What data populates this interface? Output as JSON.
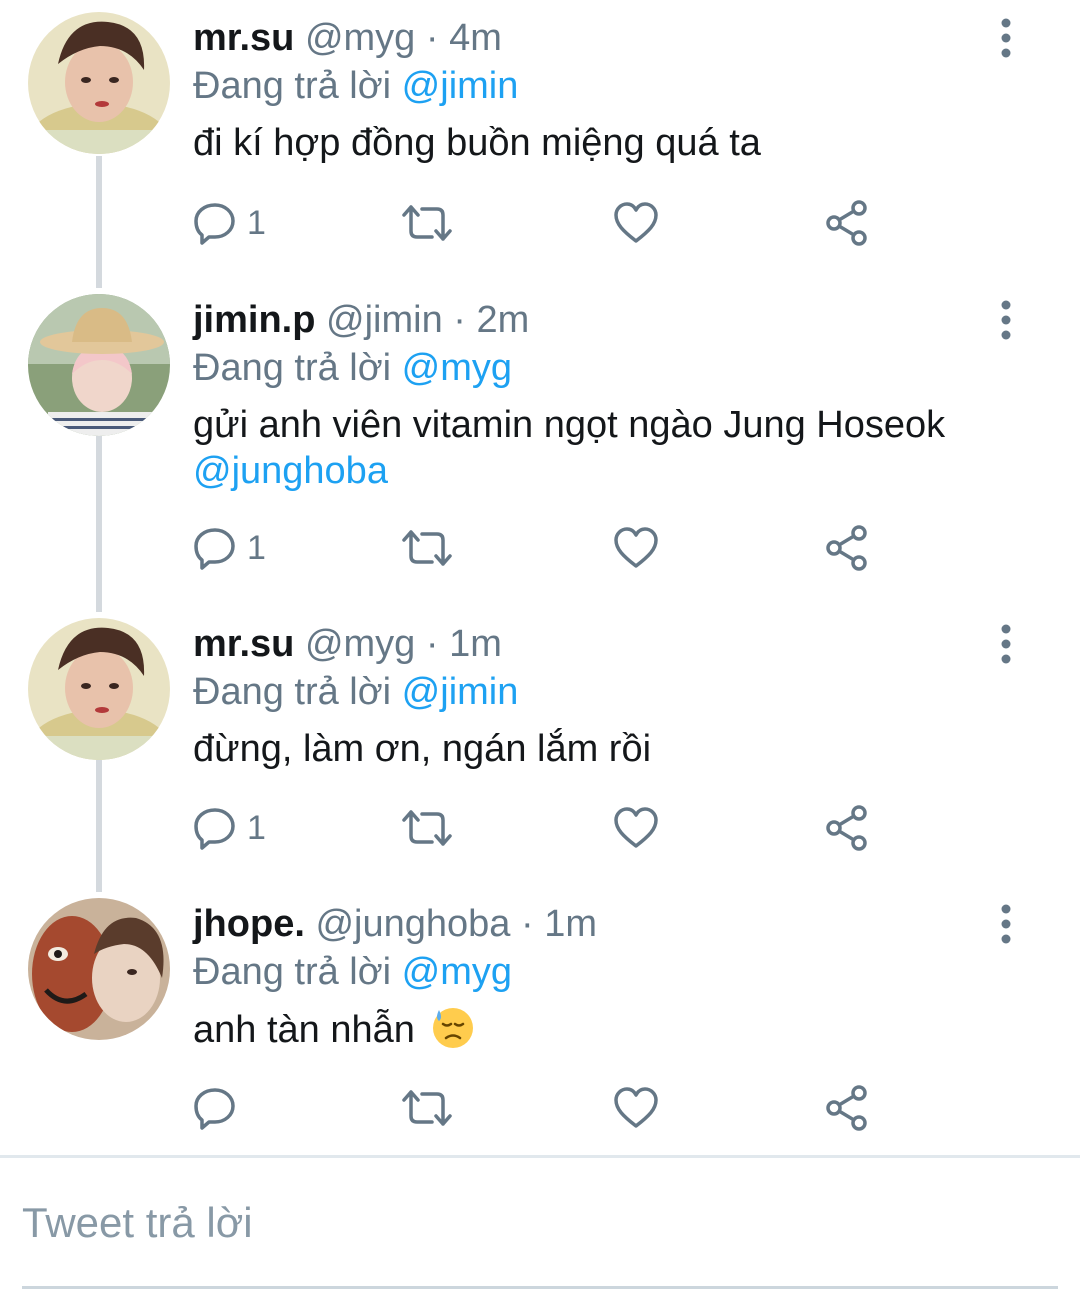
{
  "colors": {
    "mention": "#1da1f2",
    "secondary_text": "#657786",
    "thread_line": "#d4d9de"
  },
  "tweets": [
    {
      "name": "mr.su",
      "handle": "@myg",
      "dot": "·",
      "time": "4m",
      "replying_prefix": "Đang trả lời",
      "replying_to": "@jimin",
      "text": "đi kí hợp đồng buồn miệng quá ta",
      "text_mention": "",
      "reply_count": "1"
    },
    {
      "name": "jimin.p",
      "handle": "@jimin",
      "dot": "·",
      "time": "2m",
      "replying_prefix": "Đang trả lời",
      "replying_to": "@myg",
      "text": "gửi anh viên vitamin ngọt ngào Jung Hoseok",
      "text_mention": "@junghoba",
      "reply_count": "1"
    },
    {
      "name": "mr.su",
      "handle": "@myg",
      "dot": "·",
      "time": "1m",
      "replying_prefix": "Đang trả lời",
      "replying_to": "@jimin",
      "text": "đừng, làm ơn, ngán lắm rồi",
      "text_mention": "",
      "reply_count": "1"
    },
    {
      "name": "jhope.",
      "handle": "@junghoba",
      "dot": "·",
      "time": "1m",
      "replying_prefix": "Đang trả lời",
      "replying_to": "@myg",
      "text": "anh tàn nhẫn",
      "text_emoji": "downcast-face-with-sweat-emoji",
      "text_mention": "",
      "reply_count": ""
    }
  ],
  "reply_box": {
    "placeholder": "Tweet trả lời"
  },
  "icons": {
    "reply": "reply-icon",
    "retweet": "retweet-icon",
    "like": "like-icon",
    "share": "share-icon",
    "menu": "more-vertical-icon"
  }
}
